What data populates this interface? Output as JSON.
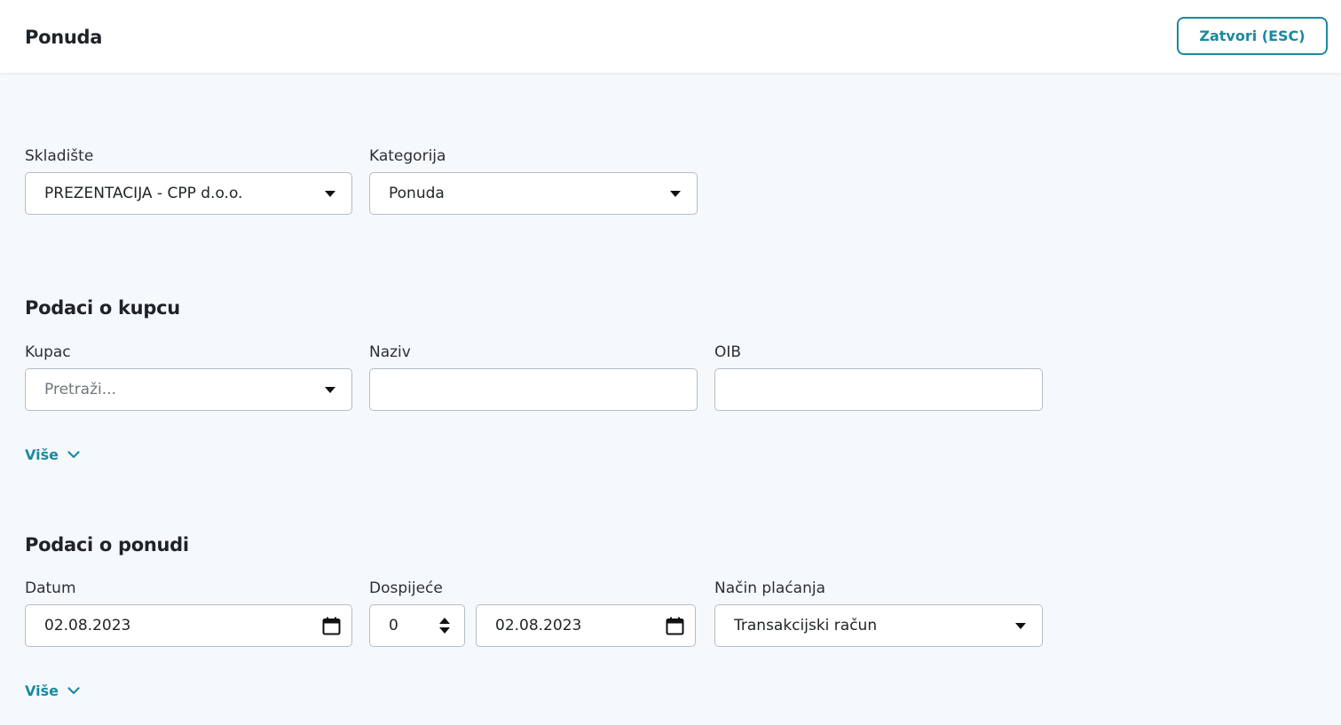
{
  "header": {
    "title": "Ponuda",
    "close_label": "Zatvori (ESC)"
  },
  "general": {
    "warehouse_label": "Skladište",
    "warehouse_value": "PREZENTACIJA - CPP d.o.o.",
    "category_label": "Kategorija",
    "category_value": "Ponuda"
  },
  "customer": {
    "section_title": "Podaci o kupcu",
    "customer_label": "Kupac",
    "customer_placeholder": "Pretraži...",
    "name_label": "Naziv",
    "name_value": "",
    "oib_label": "OIB",
    "oib_value": "",
    "more_label": "Više"
  },
  "offer": {
    "section_title": "Podaci o ponudi",
    "date_label": "Datum",
    "date_value": "02.08.2023",
    "due_label": "Dospijeće",
    "due_days_value": "0",
    "due_date_value": "02.08.2023",
    "payment_label": "Način plaćanja",
    "payment_value": "Transakcijski račun",
    "more_label": "Više"
  },
  "colors": {
    "accent": "#1a8a9e",
    "background": "#f6f9fc"
  },
  "icons": {
    "dropdown": "caret-down-icon",
    "calendar": "calendar-icon",
    "more": "chevron-down-icon",
    "spinner": "spinner-arrows-icon"
  }
}
